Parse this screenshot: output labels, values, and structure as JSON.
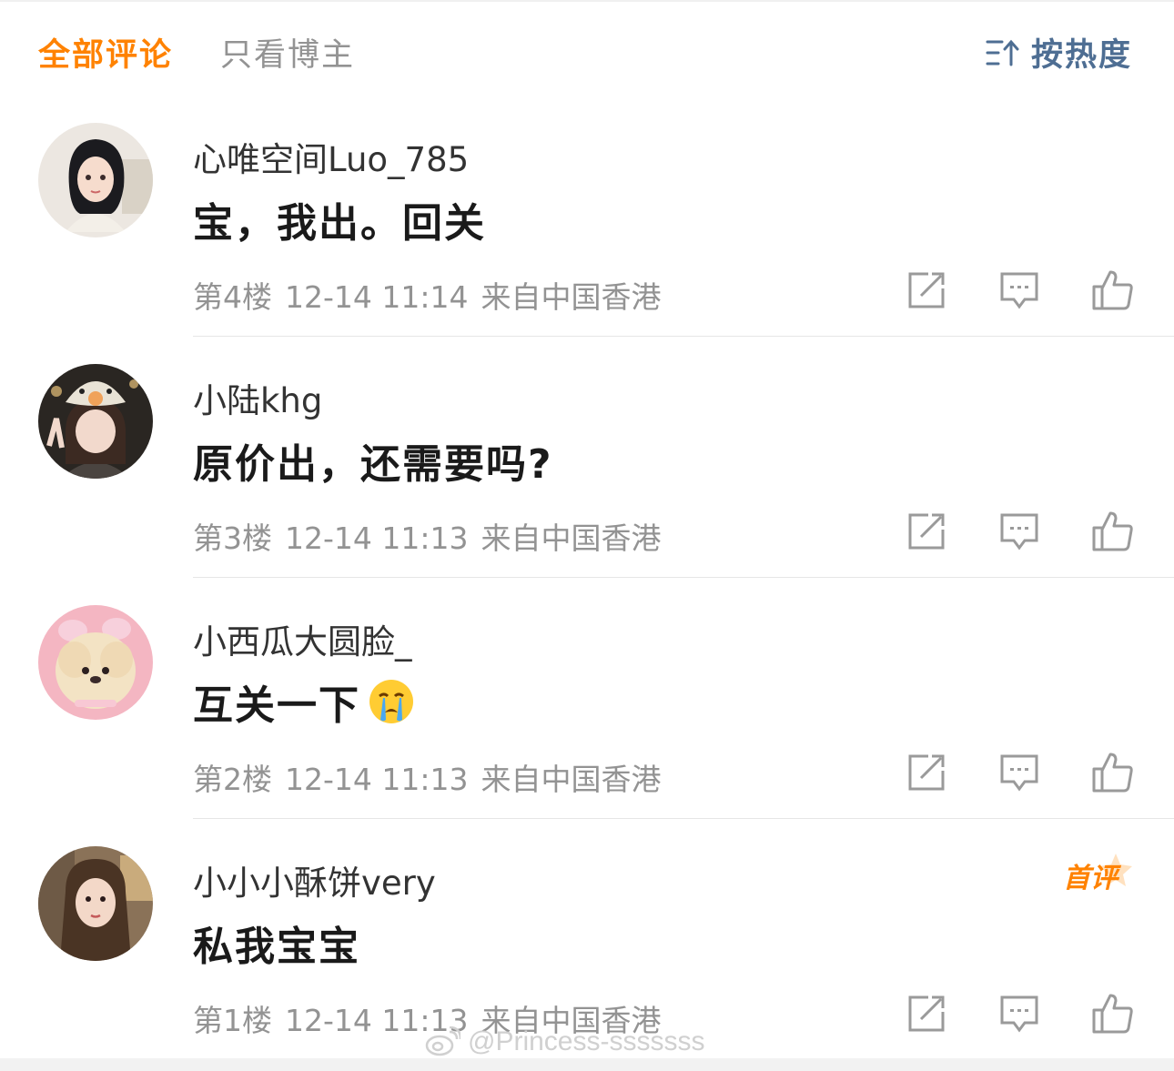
{
  "tabs": {
    "all": "全部评论",
    "blogger_only": "只看博主",
    "sort": "按热度"
  },
  "comments": [
    {
      "username": "心唯空间Luo_785",
      "text": "宝，我出。回关",
      "floor": "第4楼",
      "time": "12-14 11:14",
      "location": "来自中国香港"
    },
    {
      "username": "小陆khg",
      "text": "原价出，还需要吗?",
      "floor": "第3楼",
      "time": "12-14 11:13",
      "location": "来自中国香港"
    },
    {
      "username": "小西瓜大圆脸_",
      "text": "互关一下",
      "emoji": "crying-face",
      "floor": "第2楼",
      "time": "12-14 11:13",
      "location": "来自中国香港"
    },
    {
      "username": "小小小酥饼very",
      "text": "私我宝宝",
      "badge": "首评",
      "floor": "第1楼",
      "time": "12-14 11:13",
      "location": "来自中国香港"
    }
  ],
  "watermark": "@Princess-sssssss",
  "icons": {
    "repost": "repost-icon",
    "comment": "comment-icon",
    "like": "thumbs-up-icon",
    "sort": "sort-icon",
    "weibo": "weibo-logo-icon"
  },
  "colors": {
    "accent": "#ff8200",
    "sort_link": "#4e6e93",
    "meta": "#939393",
    "icon": "#9a9a9a"
  }
}
